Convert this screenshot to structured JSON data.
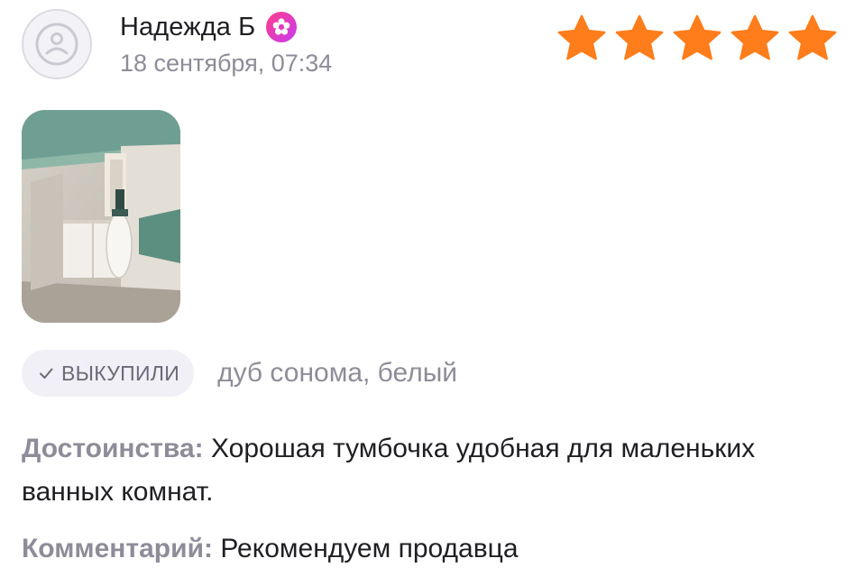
{
  "review": {
    "author": "Надежда Б",
    "date": "18 сентября, 07:34",
    "rating": 5,
    "rating_max": 5,
    "purchased_label": "ВЫКУПИЛИ",
    "variant": "дуб сонома, белый",
    "pros_label": "Достоинства:",
    "pros_text": "Хорошая тумбочка удобная для маленьких ванных комнат.",
    "comment_label": "Комментарий:",
    "comment_text": "Рекомендуем продавца"
  },
  "icons": {
    "avatar": "user-avatar-icon",
    "badge": "flower-badge-icon",
    "star": "star-icon",
    "check": "checkmark-icon"
  },
  "colors": {
    "star": "#ff7d1a",
    "label": "#8e8c98",
    "badge_start": "#ff3d8b",
    "badge_end": "#c53cf0",
    "pill_bg": "#f1f0f6"
  }
}
